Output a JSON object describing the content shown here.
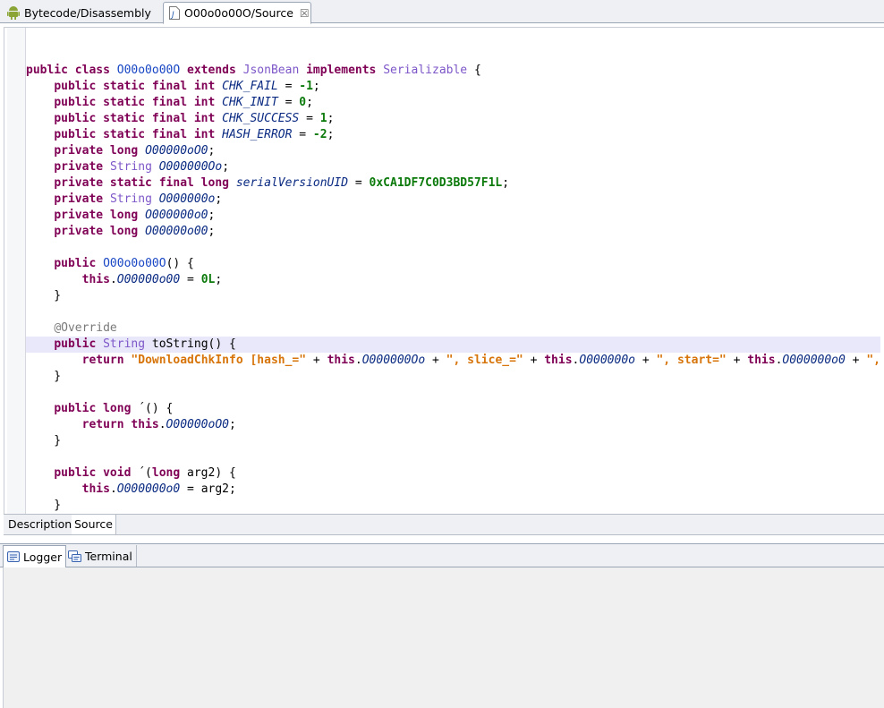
{
  "tabs": [
    {
      "label": "Bytecode/Disassembly",
      "icon": "android-icon"
    },
    {
      "label": "O00o0o00O/Source",
      "icon": "java-file-icon",
      "close": "☒"
    }
  ],
  "code_lines": [
    [],
    [
      [
        "kw",
        "public class "
      ],
      [
        "cls",
        "O00o0o00O"
      ],
      [
        "kw",
        " extends "
      ],
      [
        "ty",
        "JsonBean"
      ],
      [
        "kw",
        " implements "
      ],
      [
        "ty",
        "Serializable"
      ],
      [
        "p",
        " {"
      ]
    ],
    [
      [
        "p",
        "    "
      ],
      [
        "kw",
        "public static final int "
      ],
      [
        "fld",
        "CHK_FAIL"
      ],
      [
        "p",
        " = "
      ],
      [
        "num",
        "-1"
      ],
      [
        "p",
        ";"
      ]
    ],
    [
      [
        "p",
        "    "
      ],
      [
        "kw",
        "public static final int "
      ],
      [
        "fld",
        "CHK_INIT"
      ],
      [
        "p",
        " = "
      ],
      [
        "num",
        "0"
      ],
      [
        "p",
        ";"
      ]
    ],
    [
      [
        "p",
        "    "
      ],
      [
        "kw",
        "public static final int "
      ],
      [
        "fld",
        "CHK_SUCCESS"
      ],
      [
        "p",
        " = "
      ],
      [
        "num",
        "1"
      ],
      [
        "p",
        ";"
      ]
    ],
    [
      [
        "p",
        "    "
      ],
      [
        "kw",
        "public static final int "
      ],
      [
        "fld",
        "HASH_ERROR"
      ],
      [
        "p",
        " = "
      ],
      [
        "num",
        "-2"
      ],
      [
        "p",
        ";"
      ]
    ],
    [
      [
        "p",
        "    "
      ],
      [
        "kw",
        "private long "
      ],
      [
        "fld",
        "O00000oO0"
      ],
      [
        "p",
        ";"
      ]
    ],
    [
      [
        "p",
        "    "
      ],
      [
        "kw",
        "private "
      ],
      [
        "ty",
        "String"
      ],
      [
        "p",
        " "
      ],
      [
        "fld",
        "O000000Oo"
      ],
      [
        "p",
        ";"
      ]
    ],
    [
      [
        "p",
        "    "
      ],
      [
        "kw",
        "private static final long "
      ],
      [
        "fld",
        "serialVersionUID"
      ],
      [
        "p",
        " = "
      ],
      [
        "num",
        "0xCA1DF7C0D3BD57F1L"
      ],
      [
        "p",
        ";"
      ]
    ],
    [
      [
        "p",
        "    "
      ],
      [
        "kw",
        "private "
      ],
      [
        "ty",
        "String"
      ],
      [
        "p",
        " "
      ],
      [
        "fld",
        "O000000o"
      ],
      [
        "p",
        ";"
      ]
    ],
    [
      [
        "p",
        "    "
      ],
      [
        "kw",
        "private long "
      ],
      [
        "fld",
        "O000000o0"
      ],
      [
        "p",
        ";"
      ]
    ],
    [
      [
        "p",
        "    "
      ],
      [
        "kw",
        "private long "
      ],
      [
        "fld",
        "O00000o00"
      ],
      [
        "p",
        ";"
      ]
    ],
    [],
    [
      [
        "p",
        "    "
      ],
      [
        "kw",
        "public "
      ],
      [
        "cls",
        "O00o0o00O"
      ],
      [
        "p",
        "() {"
      ]
    ],
    [
      [
        "p",
        "        "
      ],
      [
        "kw",
        "this"
      ],
      [
        "p",
        "."
      ],
      [
        "fld",
        "O00000o00"
      ],
      [
        "p",
        " = "
      ],
      [
        "num",
        "0L"
      ],
      [
        "p",
        ";"
      ]
    ],
    [
      [
        "p",
        "    }"
      ]
    ],
    [],
    [
      [
        "p",
        "    "
      ],
      [
        "ann",
        "@Override"
      ]
    ],
    [
      [
        "p",
        "    "
      ],
      [
        "kw",
        "public "
      ],
      [
        "ty",
        "String"
      ],
      [
        "p",
        " toString() {"
      ]
    ],
    [
      [
        "p",
        "        "
      ],
      [
        "kw",
        "return "
      ],
      [
        "str",
        "\"DownloadChkInfo [hash_=\""
      ],
      [
        "p",
        " + "
      ],
      [
        "kw",
        "this"
      ],
      [
        "p",
        "."
      ],
      [
        "fld",
        "O000000Oo"
      ],
      [
        "p",
        " + "
      ],
      [
        "str",
        "\", slice_=\""
      ],
      [
        "p",
        " + "
      ],
      [
        "kw",
        "this"
      ],
      [
        "p",
        "."
      ],
      [
        "fld",
        "O000000o"
      ],
      [
        "p",
        " + "
      ],
      [
        "str",
        "\", start=\""
      ],
      [
        "p",
        " + "
      ],
      [
        "kw",
        "this"
      ],
      [
        "p",
        "."
      ],
      [
        "fld",
        "O000000o0"
      ],
      [
        "p",
        " + "
      ],
      [
        "str",
        "\","
      ]
    ],
    [
      [
        "p",
        "    }"
      ]
    ],
    [],
    [
      [
        "p",
        "    "
      ],
      [
        "kw",
        "public long "
      ],
      [
        "p",
        "´() {"
      ]
    ],
    [
      [
        "p",
        "        "
      ],
      [
        "kw",
        "return this"
      ],
      [
        "p",
        "."
      ],
      [
        "fld",
        "O00000oO0"
      ],
      [
        "p",
        ";"
      ]
    ],
    [
      [
        "p",
        "    }"
      ]
    ],
    [],
    [
      [
        "p",
        "    "
      ],
      [
        "kw",
        "public void "
      ],
      [
        "p",
        "´("
      ],
      [
        "kw",
        "long"
      ],
      [
        "p",
        " arg2) {"
      ]
    ],
    [
      [
        "p",
        "        "
      ],
      [
        "kw",
        "this"
      ],
      [
        "p",
        "."
      ],
      [
        "fld",
        "O000000o0"
      ],
      [
        "p",
        " = arg2;"
      ]
    ],
    [
      [
        "p",
        "    }"
      ]
    ]
  ],
  "highlight_line": 18,
  "subtabs": [
    "Description",
    "Source"
  ],
  "panel_tabs": [
    {
      "label": "Logger",
      "icon": "logger-icon"
    },
    {
      "label": "Terminal",
      "icon": "terminal-icon"
    }
  ]
}
